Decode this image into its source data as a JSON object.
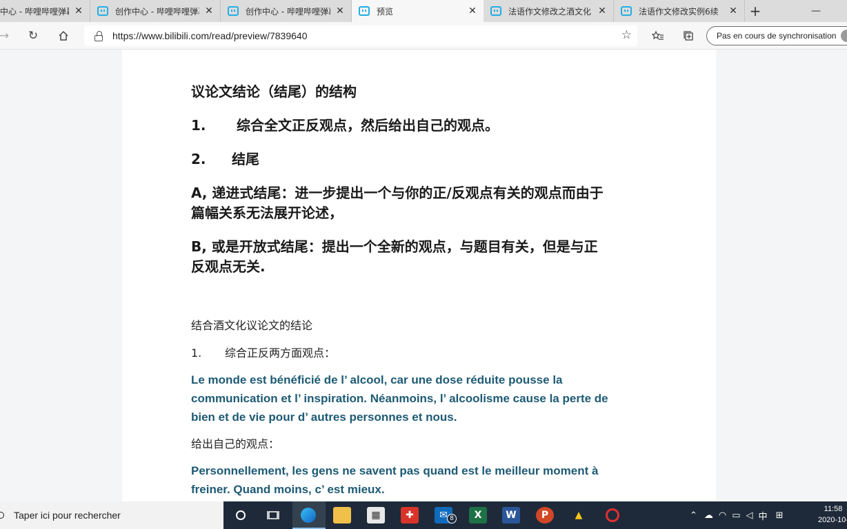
{
  "browser": {
    "tabs": [
      {
        "label": "中心 - 哔哩哔哩弹幕",
        "active": false
      },
      {
        "label": "创作中心 - 哔哩哔哩弹幕",
        "active": false
      },
      {
        "label": "创作中心 - 哔哩哔哩弹幕",
        "active": false
      },
      {
        "label": "预览",
        "active": true
      },
      {
        "label": "法语作文修改之酒文化",
        "active": false
      },
      {
        "label": "法语作文修改实例6续",
        "active": false
      }
    ],
    "url": "https://www.bilibili.com/read/preview/7839640",
    "sync_label": "Pas en cours de synchronisation",
    "accent_color": "#23ade5"
  },
  "article": {
    "heading": "议论文结论（结尾）的结构",
    "item1_num": "1.",
    "item1_text": "综合全文正反观点，然后给出自己的观点。",
    "item2_num": "2.",
    "item2_text": "结尾",
    "a_line1": "A, 递进式结尾：进一步提出一个与你的正/反观点有关的观点而由于",
    "a_line2": "篇幅关系无法展开论述，",
    "b_line1": "B, 或是开放式结尾：提出一个全新的观点，与题目有关，但是与正",
    "b_line2": "反观点无关.",
    "sub_title": "结合酒文化议论文的结论",
    "sub_item_num": "1.",
    "sub_item_text": "综合正反两方面观点：",
    "fr1_line1": "Le monde est bénéficié de l’ alcool, car une dose réduite pousse la",
    "fr1_line2": "communication et l’ inspiration. Néanmoins, l’ alcoolisme cause la perte de",
    "fr1_line3": "bien et de vie pour d’ autres personnes et nous.",
    "own_view_label": "给出自己的观点：",
    "fr2_line1": "Personnellement, les gens ne savent pas quand est le meilleur moment à",
    "fr2_line2": "freiner.  Quand moins, c’ est mieux.",
    "french_color": "#1d5a74"
  },
  "taskbar": {
    "search_placeholder": "Taper ici pour rechercher",
    "mail_badge": "8",
    "ime_label": "中",
    "time": "11:58",
    "date": "2020-10-"
  }
}
